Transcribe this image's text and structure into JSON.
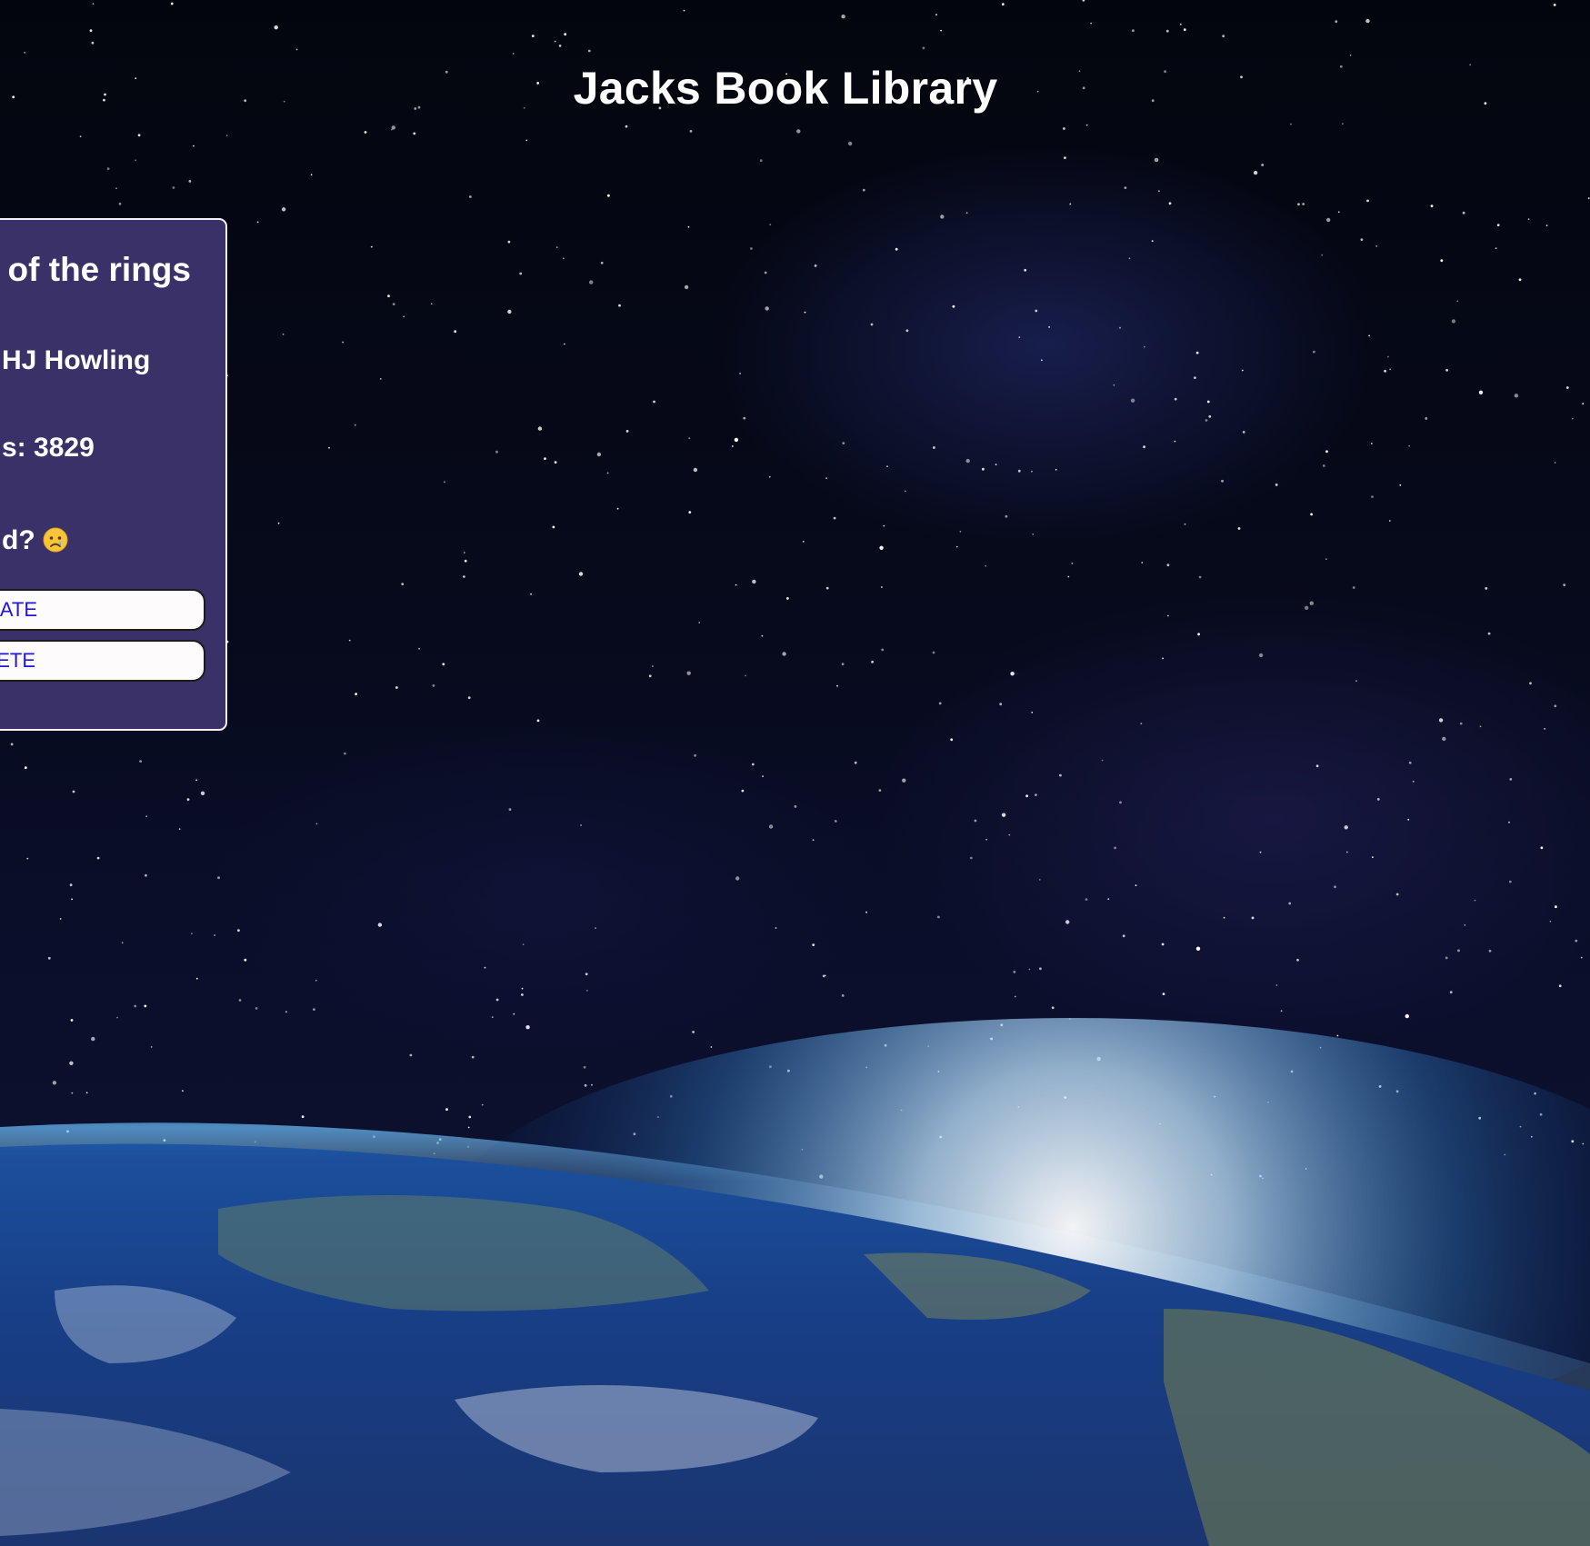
{
  "app": {
    "title": "Jacks Book Library"
  },
  "book_card": {
    "title_visible": "of the rings",
    "author_visible": "HJ Howling",
    "pages_visible": "s: 3829",
    "read_visible": "d?",
    "read_status_icon": "crying-face-emoji",
    "update_label_visible": "DATE",
    "delete_label_visible": "LETE"
  },
  "colors": {
    "card_background": "#3a3168",
    "card_border": "#f4f2fa",
    "button_background": "#fdfbfb",
    "button_text": "#2316d6"
  }
}
